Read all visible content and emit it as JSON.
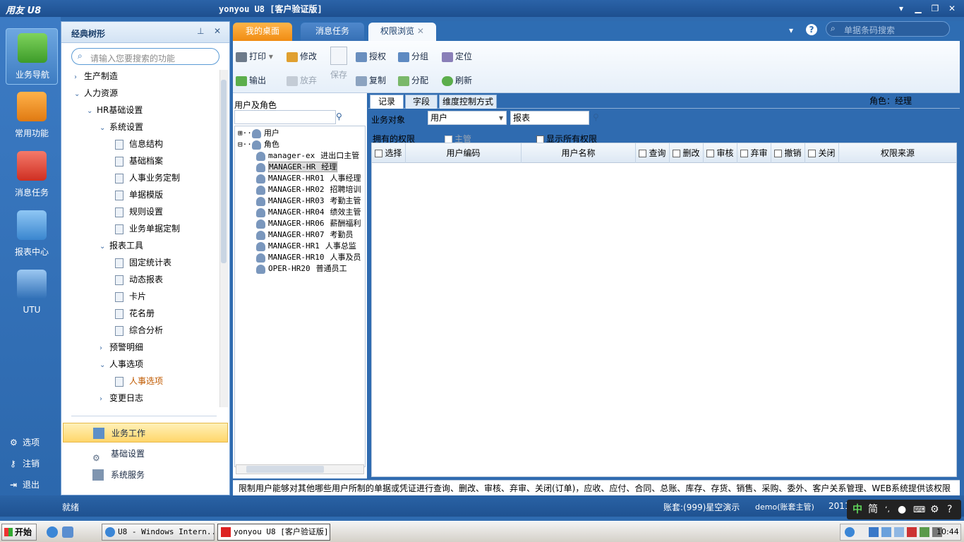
{
  "window": {
    "app_logo": "用友 U8",
    "title": "yonyou U8 [客户验证版]"
  },
  "rail": {
    "items": [
      {
        "label": "业务导航"
      },
      {
        "label": "常用功能"
      },
      {
        "label": "消息任务"
      },
      {
        "label": "报表中心"
      },
      {
        "label": "UTU"
      }
    ],
    "bottom": [
      {
        "label": "选项"
      },
      {
        "label": "注销"
      },
      {
        "label": "退出"
      }
    ]
  },
  "tree_panel": {
    "title": "经典树形",
    "search_placeholder": "请输入您要搜索的功能",
    "rows": [
      {
        "level": 0,
        "arrow": "›",
        "label": "生产制造"
      },
      {
        "level": 0,
        "arrow": "⌄",
        "label": "人力资源"
      },
      {
        "level": 1,
        "arrow": "⌄",
        "label": "HR基础设置"
      },
      {
        "level": 2,
        "arrow": "⌄",
        "label": "系统设置"
      },
      {
        "level": 3,
        "doc": true,
        "label": "信息结构"
      },
      {
        "level": 3,
        "doc": true,
        "label": "基础档案"
      },
      {
        "level": 3,
        "doc": true,
        "label": "人事业务定制"
      },
      {
        "level": 3,
        "doc": true,
        "label": "单据模版"
      },
      {
        "level": 3,
        "doc": true,
        "label": "规则设置"
      },
      {
        "level": 3,
        "doc": true,
        "label": "业务单据定制"
      },
      {
        "level": 2,
        "arrow": "⌄",
        "label": "报表工具"
      },
      {
        "level": 3,
        "doc": true,
        "label": "固定统计表"
      },
      {
        "level": 3,
        "doc": true,
        "label": "动态报表"
      },
      {
        "level": 3,
        "doc": true,
        "label": "卡片"
      },
      {
        "level": 3,
        "doc": true,
        "label": "花名册"
      },
      {
        "level": 3,
        "doc": true,
        "label": "综合分析"
      },
      {
        "level": 2,
        "arrow": "›",
        "label": "预警明细"
      },
      {
        "level": 2,
        "arrow": "⌄",
        "label": "人事选项"
      },
      {
        "level": 3,
        "doc": true,
        "label": "人事选项",
        "highlight": true
      },
      {
        "level": 2,
        "arrow": "›",
        "label": "变更日志"
      }
    ],
    "bottom_nav": [
      {
        "label": "业务工作",
        "selected": true
      },
      {
        "label": "基础设置"
      },
      {
        "label": "系统服务"
      }
    ]
  },
  "tabs": [
    {
      "label": "我的桌面"
    },
    {
      "label": "消息任务"
    },
    {
      "label": "权限浏览"
    }
  ],
  "global_search_placeholder": "单据条码搜索",
  "toolbar": {
    "print": "打印",
    "export": "输出",
    "modify": "修改",
    "discard": "放弃",
    "save": "保存",
    "grant": "授权",
    "copy": "复制",
    "group": "分组",
    "assign": "分配",
    "locate": "定位",
    "refresh": "刷新"
  },
  "user_role": {
    "label": "用户及角色",
    "nodes": [
      {
        "label": "用户",
        "expander": "⊞"
      },
      {
        "label": "角色",
        "expander": "⊟"
      }
    ],
    "roles": [
      {
        "code": "manager-ex",
        "name": "进出口主管"
      },
      {
        "code": "MANAGER-HR",
        "name": "经理",
        "selected": true
      },
      {
        "code": "MANAGER-HR01",
        "name": "人事经理"
      },
      {
        "code": "MANAGER-HR02",
        "name": "招聘培训"
      },
      {
        "code": "MANAGER-HR03",
        "name": "考勤主管"
      },
      {
        "code": "MANAGER-HR04",
        "name": "绩效主管"
      },
      {
        "code": "MANAGER-HR06",
        "name": "薪酬福利"
      },
      {
        "code": "MANAGER-HR07",
        "name": "考勤员"
      },
      {
        "code": "MANAGER-HR1",
        "name": "人事总监"
      },
      {
        "code": "MANAGER-HR10",
        "name": "人事及员"
      },
      {
        "code": "OPER-HR20",
        "name": "普通员工"
      }
    ]
  },
  "subtabs": [
    {
      "label": "记录"
    },
    {
      "label": "字段"
    },
    {
      "label": "维度控制方式"
    }
  ],
  "role_display": "角色：经理",
  "filters": {
    "business_object_label": "业务对象",
    "object_value": "用户",
    "report_value": "报表",
    "owned_label": "拥有的权限",
    "supervisor_label": "主管",
    "show_all_label": "显示所有权限"
  },
  "grid": {
    "columns": [
      "选择",
      "用户编码",
      "用户名称",
      "查询",
      "删改",
      "审核",
      "弃审",
      "撤销",
      "关闭",
      "权限来源"
    ]
  },
  "description": "限制用户能够对其他哪些用户所制的单据或凭证进行查询、删改、审核、弃审、关闭(订单)，应收、应付、合同、总账、库存、存货、销售、采购、委外、客户关系管理、WEB系统提供该权限",
  "status": {
    "ready": "就绪",
    "account": "账套:(999)星空演示",
    "user": "demo(账套主管)",
    "year": "2011"
  },
  "ime": {
    "mode": "中",
    "simp": "简"
  },
  "taskbar": {
    "start": "开始",
    "tasks": [
      {
        "label": "U8 - Windows Intern..."
      },
      {
        "label": "yonyou U8 [客户验证版]",
        "active": true
      }
    ],
    "clock": "10:44"
  },
  "colors": {
    "accent_blue": "#2e6db3",
    "tab_orange": "#f08c12",
    "selection_yellow": "#ffd66b"
  }
}
